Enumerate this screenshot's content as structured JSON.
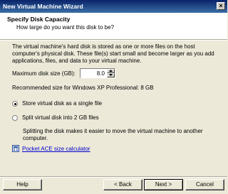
{
  "window": {
    "title": "New Virtual Machine Wizard",
    "close_label": "×"
  },
  "header": {
    "title": "Specify Disk Capacity",
    "subtitle": "How large do you want this disk to be?"
  },
  "content": {
    "description": "The virtual machine's hard disk is stored as one or more files on the host computer's physical disk. These file(s) start small and become larger as you add applications, files, and data to your virtual machine.",
    "max_size_label": "Maximum disk size (GB):",
    "max_size_value": "8.0",
    "recommended": "Recommended size for Windows XP Professional: 8 GB",
    "option_single": "Store virtual disk as a single file",
    "option_split": "Split virtual disk into 2 GB files",
    "selected_option": "single",
    "split_description": "Splitting the disk makes it easier to move the virtual machine to another computer.",
    "calculator_link": "Pocket ACE size calculator"
  },
  "buttons": {
    "help": "Help",
    "back": "< Back",
    "next": "Next >",
    "cancel": "Cancel"
  }
}
